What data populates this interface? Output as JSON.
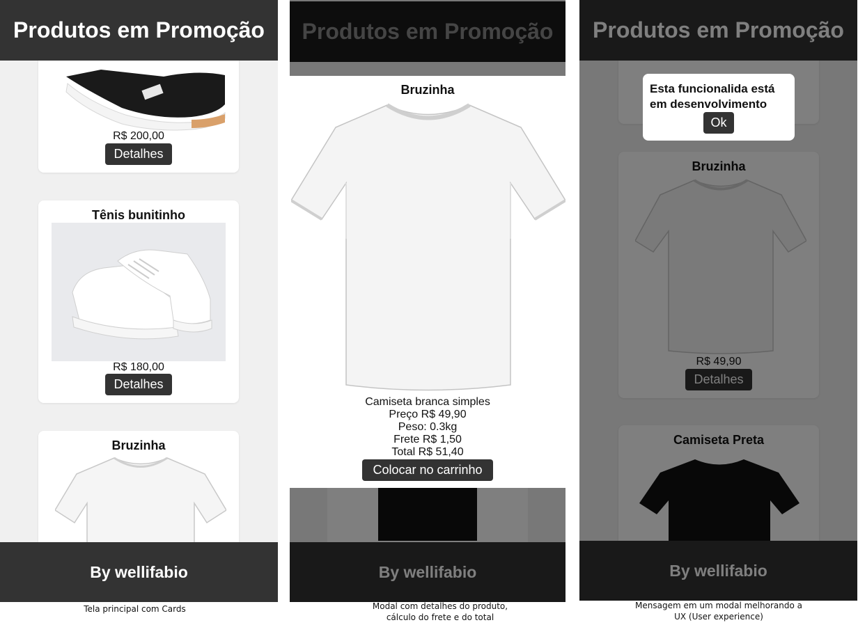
{
  "header_title": "Produtos em Promoção",
  "footer_text": "By wellifabio",
  "screen1": {
    "caption": "Tela principal com Cards",
    "cards": [
      {
        "title": "",
        "price": "R$ 200,00",
        "button": "Detalhes",
        "image": "sneaker-black-image"
      },
      {
        "title": "Tênis bunitinho",
        "price": "R$ 180,00",
        "button": "Detalhes",
        "image": "sneaker-white-image"
      },
      {
        "title": "Bruzinha",
        "price": "",
        "button": "",
        "image": "tshirt-white-image"
      }
    ]
  },
  "screen2": {
    "caption_line1": "Modal com detalhes do produto,",
    "caption_line2": "cálculo do frete e do total",
    "modal": {
      "title": "Bruzinha",
      "description": "Camiseta branca simples",
      "price": "Preço R$ 49,90",
      "weight": "Peso: 0.3kg",
      "shipping": "Frete R$ 1,50",
      "total": "Total R$ 51,40",
      "button": "Colocar no carrinho"
    }
  },
  "screen3": {
    "caption_line1": "Mensagem em um modal melhorando a",
    "caption_line2": "UX (User experience)",
    "alert": {
      "message_line1": "Esta funcionalida está",
      "message_line2": "em desenvolvimento",
      "button": "Ok"
    },
    "cards": [
      {
        "title": "Bruzinha",
        "price": "R$ 49,90",
        "button": "Detalhes"
      },
      {
        "title": "Camiseta Preta"
      }
    ]
  },
  "colors": {
    "dark": "#333333",
    "background": "#f0f0f0",
    "card": "#ffffff"
  }
}
